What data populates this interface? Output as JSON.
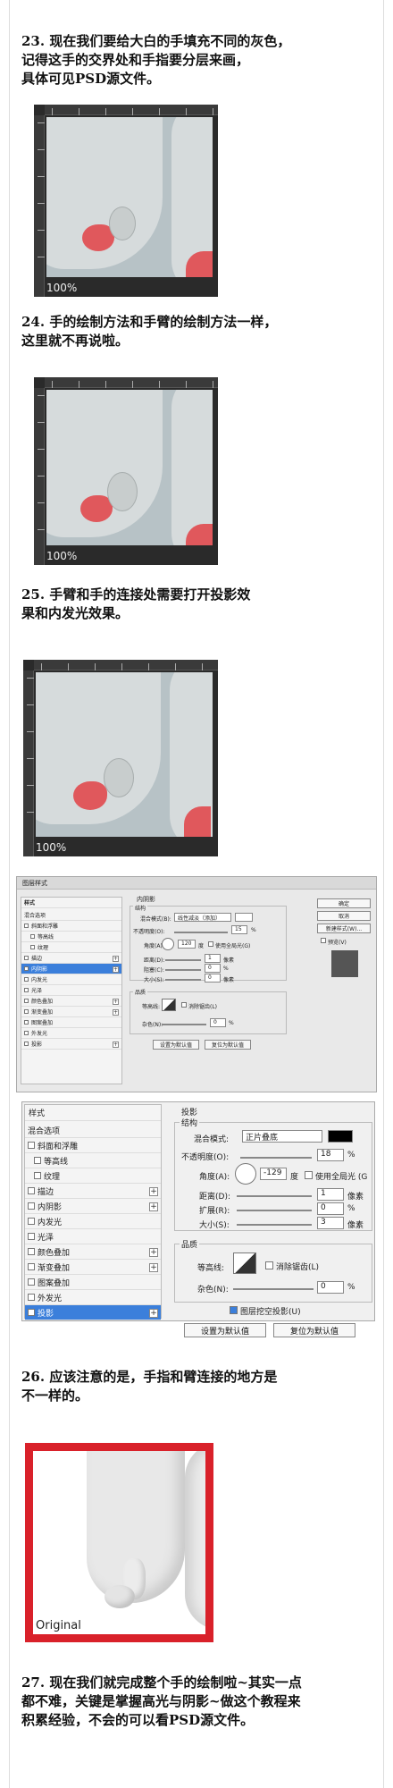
{
  "steps": [
    {
      "num": "23.",
      "text": "现在我们要给大白的手填充不同的灰色，\n记得这手的交界处和手指要分层来画，\n具体可见PSD源文件。"
    },
    {
      "num": "24.",
      "text": "手的绘制方法和手臂的绘制方法一样，\n这里就不再说啦。"
    },
    {
      "num": "25.",
      "text": "手臂和手的连接处需要打开投影效\n果和内发光效果。"
    },
    {
      "num": "26.",
      "text": "应该注意的是，手指和臂连接的地方是\n不一样的。"
    },
    {
      "num": "27.",
      "text": "现在我们就完成整个手的绘制啦~其实一点\n都不难，关键是掌握高光与阴影~做这个教程来\n积累经验，不会的可以看PSD源文件。"
    }
  ],
  "canvases": [
    {
      "zoom": "100%"
    },
    {
      "zoom": "100%"
    },
    {
      "zoom": "100%"
    }
  ],
  "dialog_small": {
    "title": "图层样式",
    "styles_header": "样式",
    "items": [
      "混合选项",
      "斜面和浮雕",
      "等高线",
      "纹理",
      "描边",
      "内阴影",
      "内发光",
      "光泽",
      "颜色叠加",
      "渐变叠加",
      "图案叠加",
      "外发光",
      "投影"
    ],
    "active_item": "内阴影",
    "section": "内阴影",
    "structure": "结构",
    "blend_mode_label": "混合模式(B):",
    "blend_mode": "线性减淡（添加）",
    "opacity_label": "不透明度(O):",
    "opacity": "15",
    "angle_label": "角度(A):",
    "angle": "120",
    "global_light": "使用全局光(G)",
    "distance_label": "距离(D):",
    "distance": "1",
    "choke_label": "阻塞(C):",
    "choke": "0",
    "size_label": "大小(S):",
    "size": "0",
    "unit_px": "像素",
    "unit_pct": "%",
    "degree": "度",
    "quality": "品质",
    "contour_label": "等高线:",
    "antialias": "消除锯齿(L)",
    "noise_label": "杂色(N):",
    "noise": "0",
    "set_default": "设置为默认值",
    "reset_default": "复位为默认值",
    "ok": "确定",
    "cancel": "取消",
    "new_style": "新建样式(W)...",
    "preview": "预览(V)"
  },
  "dialog_large": {
    "styles_header": "样式",
    "items": [
      "混合选项",
      "斜面和浮雕",
      "等高线",
      "纹理",
      "描边",
      "内阴影",
      "内发光",
      "光泽",
      "颜色叠加",
      "渐变叠加",
      "图案叠加",
      "外发光",
      "投影"
    ],
    "active_item": "投影",
    "section": "投影",
    "structure": "结构",
    "blend_mode_label": "混合模式:",
    "blend_mode": "正片叠底",
    "opacity_label": "不透明度(O):",
    "opacity": "18",
    "angle_label": "角度(A):",
    "angle": "-129",
    "degree": "度",
    "global_light": "使用全局光 (G",
    "distance_label": "距离(D):",
    "distance": "1",
    "spread_label": "扩展(R):",
    "spread": "0",
    "size_label": "大小(S):",
    "size": "3",
    "unit_px": "像素",
    "unit_pct": "%",
    "quality": "品质",
    "contour_label": "等高线:",
    "antialias": "消除锯齿(L)",
    "noise_label": "杂色(N):",
    "noise": "0",
    "knockout": "图层挖空投影(U)",
    "set_default": "设置为默认值",
    "reset_default": "复位为默认值"
  },
  "original_label": "Original",
  "colors": {
    "accent_red": "#d9212a",
    "selection_blue": "#3b7fdb",
    "canvas_gray": "#b7c2c6"
  }
}
